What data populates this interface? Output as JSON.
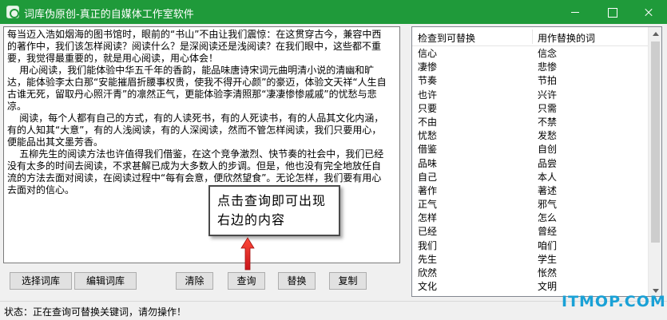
{
  "window": {
    "title": "词库伪原创-真正的自媒体工作室软件",
    "min_icon": "minimize-icon",
    "max_icon": "maximize-icon",
    "close_icon": "close-icon"
  },
  "editor": {
    "text": "每当迈入浩如烟海的图书馆时，眼前的“书山”不由让我们震惊：在这贯穿古今，兼容中西的著作中，我们该怎样阅读？阅读什么？是深阅读还是浅阅读？在我们眼中，这些都不重要，我觉得最重要的，就是用心阅读，用心体会！\n    用心阅读，我们能体验中华五千年的香韵，能品味唐诗宋词元曲明清小说的清幽和旷达，能体验李太白那“安能摧眉折腰事权贵，使我不得开心颜”的豪迈，体验文天祥“人生自古谁无死，留取丹心照汗青”的凛然正气，更能体验李清照那“凄凄惨惨戚戚”的忧愁与悲凉。\n    阅读，每个人都有自己的方式，有的人读死书，有的人死读书，有的人品其文化内涵，有的人知其“大意”，有的人浅阅读，有的人深阅读，然而不管怎样阅读，我们只要用心，便能品出其文墨芳香。\n    五柳先生的阅读方法也许值得我们借鉴，在这个竞争激烈、快节奏的社会中，我们已经没有太多的时间去阅读，不求甚解已成为大多数人的步调。但是，他也没有完全地放任自流的方法去面对阅读，在阅读过程中“每有会意，便欣然望食”。无论怎样，我们要有用心去面对的信心。"
  },
  "buttons": {
    "select_lib": "选择词库",
    "edit_lib": "编辑词库",
    "clear": "清除",
    "query": "查询",
    "replace": "替换",
    "copy": "复制"
  },
  "status": {
    "text": "状态：正在查询可替换关键词，请勿操作！"
  },
  "word_list": {
    "columns": [
      "检查到可替换",
      "用作替换的词"
    ],
    "rows": [
      [
        "信心",
        "信念"
      ],
      [
        "凄惨",
        "悲惨"
      ],
      [
        "节奏",
        "节拍"
      ],
      [
        "也许",
        "兴许"
      ],
      [
        "只要",
        "只需"
      ],
      [
        "不由",
        "不禁"
      ],
      [
        "忧愁",
        "发愁"
      ],
      [
        "借鉴",
        "自创"
      ],
      [
        "品味",
        "品尝"
      ],
      [
        "自己",
        "本人"
      ],
      [
        "著作",
        "著述"
      ],
      [
        "正气",
        "邪气"
      ],
      [
        "怎样",
        "怎么"
      ],
      [
        "已经",
        "曾经"
      ],
      [
        "我们",
        "咱们"
      ],
      [
        "先生",
        "学生"
      ],
      [
        "欣然",
        "怅然"
      ],
      [
        "文化",
        "文明"
      ]
    ],
    "scroll_up_icon": "scroll-up-arrow-icon",
    "scroll_down_icon": "scroll-down-arrow-icon"
  },
  "tooltip": {
    "text": "点击查询即可出现右边的内容"
  },
  "watermark": {
    "text": "ITMOP.COM"
  },
  "colors": {
    "titlebar": "#1f9a3a",
    "arrow": "#e02020",
    "watermark": "#1aa1d6"
  }
}
